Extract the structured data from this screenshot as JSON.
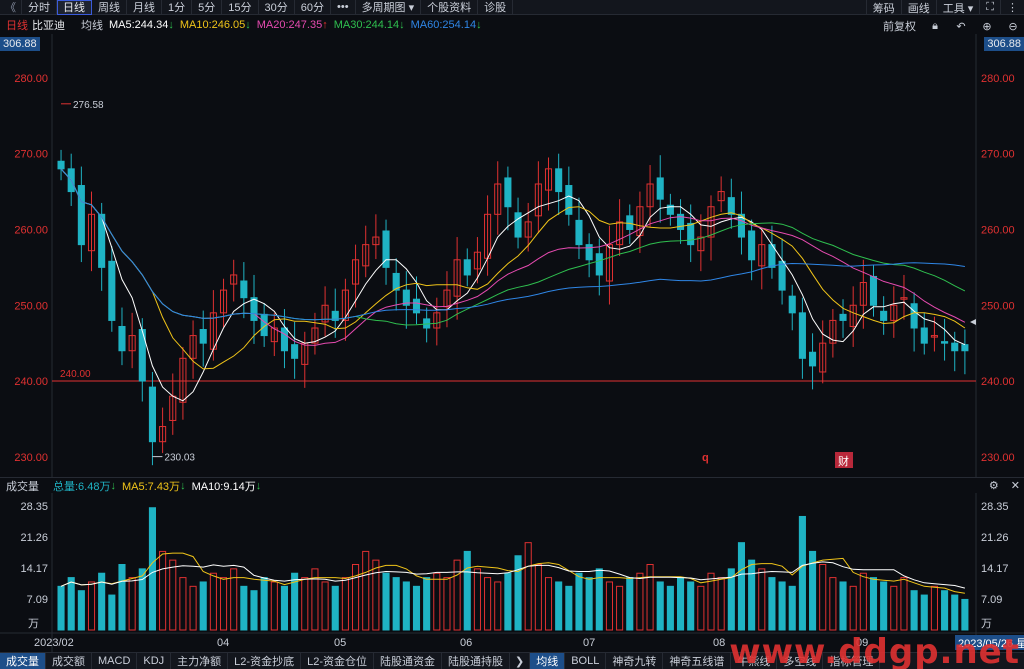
{
  "toolbar": {
    "items": [
      {
        "label": "分时",
        "active": false
      },
      {
        "label": "日线",
        "active": true
      },
      {
        "label": "周线",
        "active": false
      },
      {
        "label": "月线",
        "active": false
      },
      {
        "label": "1分",
        "active": false
      },
      {
        "label": "5分",
        "active": false
      },
      {
        "label": "15分",
        "active": false
      },
      {
        "label": "30分",
        "active": false
      },
      {
        "label": "60分",
        "active": false
      },
      {
        "label": "•••",
        "active": false
      },
      {
        "label": "多周期图 ▾",
        "active": false
      },
      {
        "label": "个股资料",
        "active": false
      },
      {
        "label": "诊股",
        "active": false
      }
    ],
    "right": [
      "筹码",
      "画线",
      "工具 ▾"
    ]
  },
  "ma_bar": {
    "period": "日线",
    "stock": "比亚迪",
    "ma_title": "均线",
    "ma5": "MA5:244.34",
    "ma10": "MA10:246.05",
    "ma20": "MA20:247.35",
    "ma30": "MA30:244.14",
    "ma60": "MA60:254.14",
    "fuquan": "前复权"
  },
  "colors": {
    "up": "#e03131",
    "down": "#1fb3c4",
    "ma5": "#ffffff",
    "ma10": "#f0c419",
    "ma20": "#e64bb0",
    "ma30": "#2fbf4f",
    "ma60": "#2f86e6"
  },
  "price_axis": {
    "top_label": "306.88",
    "ticks": [
      "280.00",
      "270.00",
      "260.00",
      "250.00",
      "240.00",
      "230.00"
    ]
  },
  "annotations": {
    "high": "276.58",
    "low": "230.03",
    "support_label": "240.00",
    "marker_q": "q",
    "marker_cai": "财"
  },
  "volume": {
    "title": "成交量",
    "total": "总量:6.48万",
    "ma5": "MA5:7.43万",
    "ma10": "MA10:9.14万",
    "ticks": [
      "28.35",
      "21.26",
      "14.17",
      "7.09"
    ],
    "unit": "万"
  },
  "date_axis": {
    "labels": [
      "2023/02",
      "04",
      "05",
      "06",
      "07",
      "08",
      "09"
    ],
    "end_label": "2023/05/26 星"
  },
  "bottom_tabs": {
    "left": [
      "成交量",
      "成交额",
      "MACD",
      "KDJ",
      "主力净额",
      "L2-资金抄底",
      "L2-资金仓位",
      "陆股通资金",
      "陆股通持股"
    ],
    "right": [
      "均线",
      "BOLL",
      "神奇九转",
      "神奇五线谱",
      "牛熊线",
      "多空线",
      "指标管理"
    ]
  },
  "watermark": "www.ddgp.net",
  "chart_data": {
    "type": "candlestick",
    "title": "比亚迪 日线",
    "x_range": [
      "2023/02",
      "2023/09"
    ],
    "ylim": [
      228,
      285
    ],
    "support_line": 240.0,
    "high": 276.58,
    "low": 230.03,
    "closes": [
      268,
      265,
      258,
      262,
      255,
      248,
      244,
      246,
      240,
      232,
      234,
      238,
      243,
      246,
      245,
      249,
      252,
      254,
      251,
      248,
      246,
      247,
      244,
      243,
      245,
      247,
      250,
      248,
      252,
      256,
      258,
      259,
      255,
      252,
      250,
      249,
      247,
      249,
      252,
      256,
      254,
      257,
      262,
      266,
      263,
      259,
      261,
      266,
      268,
      265,
      262,
      258,
      256,
      254,
      258,
      261,
      260,
      263,
      266,
      264,
      262,
      260,
      258,
      259,
      263,
      265,
      262,
      259,
      256,
      258,
      255,
      252,
      249,
      243,
      242,
      245,
      248,
      248,
      250,
      253,
      250,
      248,
      250,
      251,
      247,
      245,
      246,
      245,
      244,
      244
    ],
    "volume_values": [
      10,
      12,
      9,
      11,
      13,
      8,
      15,
      12,
      14,
      28,
      18,
      16,
      12,
      10,
      11,
      13,
      12,
      14,
      10,
      9,
      12,
      11,
      10,
      13,
      12,
      14,
      11,
      10,
      12,
      15,
      18,
      16,
      13,
      12,
      11,
      10,
      12,
      13,
      12,
      16,
      18,
      14,
      12,
      11,
      13,
      17,
      20,
      15,
      12,
      11,
      10,
      13,
      12,
      14,
      11,
      10,
      12,
      13,
      15,
      11,
      10,
      12,
      11,
      10,
      13,
      12,
      14,
      20,
      16,
      14,
      12,
      11,
      10,
      26,
      18,
      15,
      12,
      11,
      10,
      13,
      12,
      11,
      10,
      12,
      9,
      8,
      10,
      9,
      8,
      7
    ],
    "ma_lines": [
      "MA5",
      "MA10",
      "MA20",
      "MA30",
      "MA60"
    ]
  }
}
